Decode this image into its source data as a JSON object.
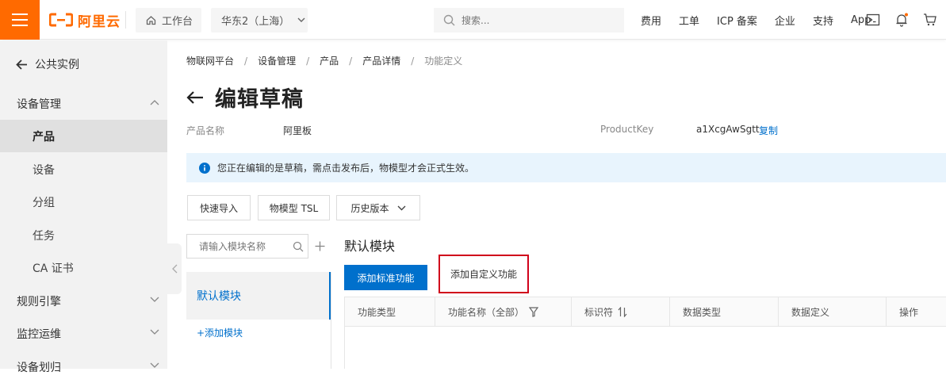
{
  "topbar": {
    "brand": "阿里云",
    "workbench": "工作台",
    "region": "华东2（上海）",
    "search_placeholder": "搜索...",
    "links": [
      "费用",
      "工单",
      "ICP 备案",
      "企业",
      "支持",
      "App"
    ],
    "accent": "#ff6a00"
  },
  "sidebar": {
    "back_label": "公共实例",
    "groups": [
      {
        "label": "设备管理",
        "expanded": true,
        "items": [
          "产品",
          "设备",
          "分组",
          "任务",
          "CA 证书"
        ],
        "active_item": "产品"
      },
      {
        "label": "规则引擎",
        "expanded": false
      },
      {
        "label": "监控运维",
        "expanded": false
      },
      {
        "label": "设备划归",
        "expanded": false
      }
    ]
  },
  "breadcrumb": [
    "物联网平台",
    "设备管理",
    "产品",
    "产品详情",
    "功能定义"
  ],
  "page": {
    "title": "编辑草稿",
    "product_name_label": "产品名称",
    "product_name": "阿里板",
    "product_key_label": "ProductKey",
    "product_key": "a1XcgAwSgtt",
    "copy_label": "复制",
    "notice": "您正在编辑的是草稿，需点击发布后，物模型才会正式生效。"
  },
  "toolbar": {
    "quick_import": "快速导入",
    "tsl": "物模型 TSL",
    "history": "历史版本"
  },
  "modules": {
    "search_placeholder": "请输入模块名称",
    "items": [
      "默认模块"
    ],
    "add_label": "+添加模块"
  },
  "main": {
    "section_title": "默认模块",
    "add_standard": "添加标准功能",
    "add_custom": "添加自定义功能",
    "columns": [
      "功能类型",
      "功能名称（全部）",
      "标识符",
      "数据类型",
      "数据定义",
      "操作"
    ]
  },
  "colors": {
    "primary": "#0070cc",
    "highlight_border": "#d0021b",
    "notice_bg": "#e8f4fd"
  }
}
